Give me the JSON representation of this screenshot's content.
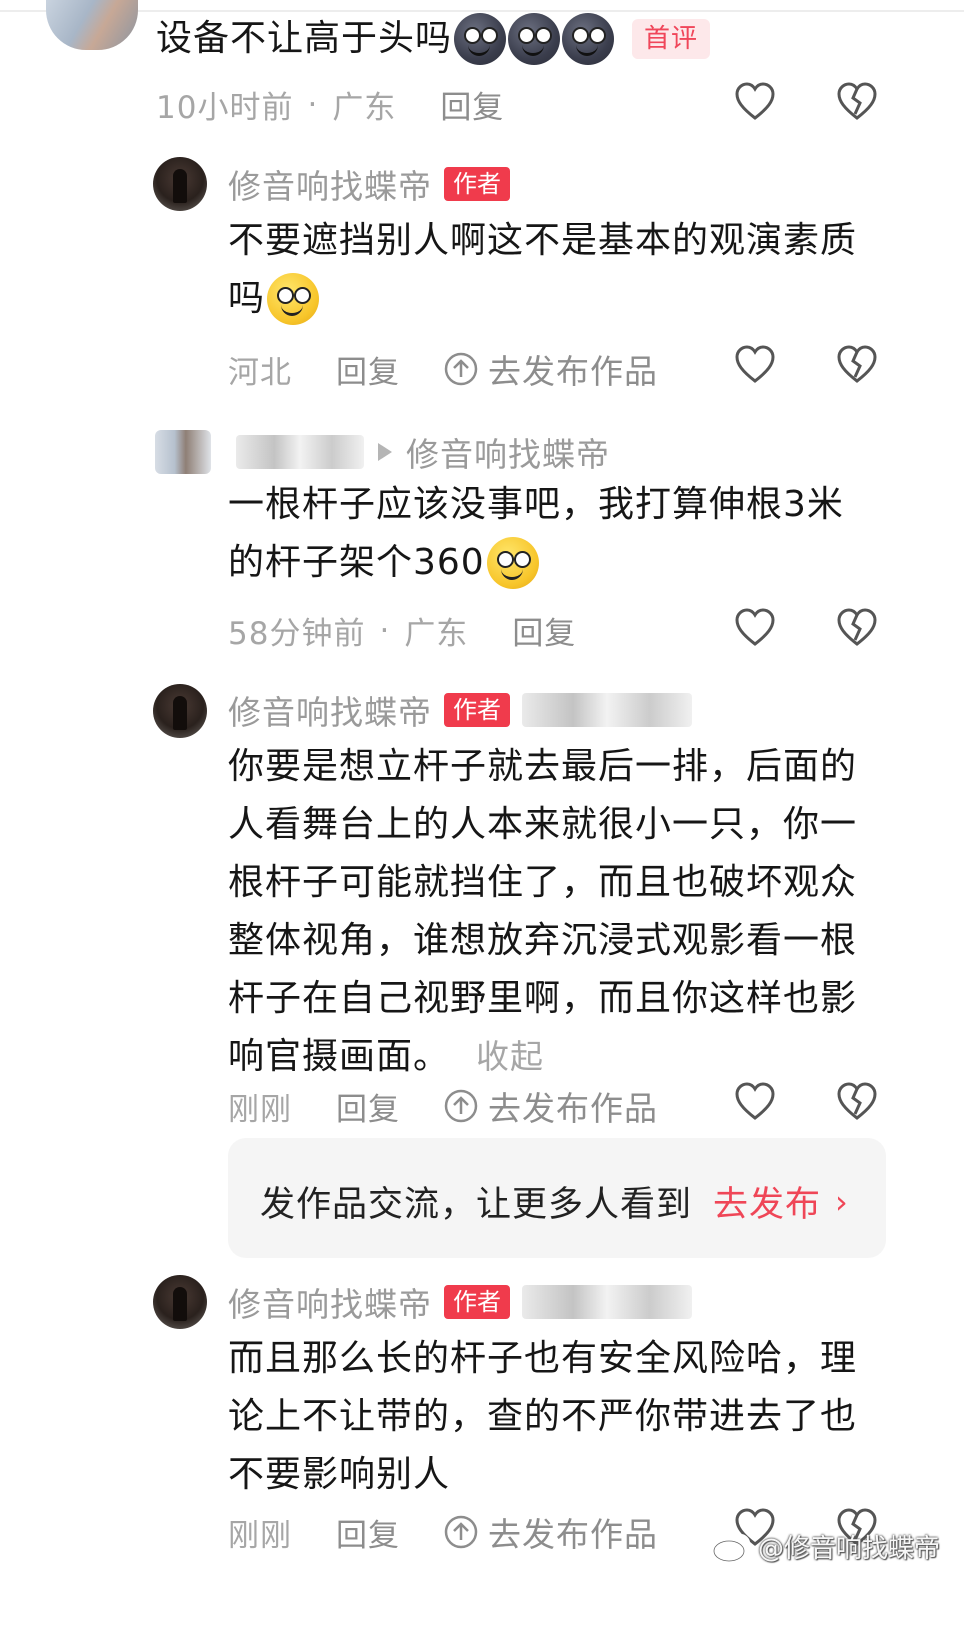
{
  "colors": {
    "accent": "#ef4657",
    "author_badge": "#f03b4c",
    "meta": "#a6a6a6"
  },
  "comments": [
    {
      "text": "设备不让高于头吗",
      "emojis": [
        "dark-moon-face",
        "dark-moon-face",
        "dark-moon-face"
      ],
      "badge": "首评",
      "time": "10小时前",
      "location": "广东",
      "reply_label": "回复"
    },
    {
      "username": "修音响找蝶帝",
      "badge": "作者",
      "text_line1": "不要遮挡别人啊这不是基本的观演素质",
      "text_line2": "吗",
      "emojis": [
        "grin-face"
      ],
      "location": "河北",
      "reply_label": "回复",
      "publish_label": "去发布作品"
    },
    {
      "reply_to": "修音响找蝶帝",
      "text_line1": "一根杆子应该没事吧，我打算伸根3米",
      "text_line2": "的杆子架个360",
      "emojis": [
        "grin-face"
      ],
      "time": "58分钟前",
      "location": "广东",
      "reply_label": "回复"
    },
    {
      "username": "修音响找蝶帝",
      "badge": "作者",
      "text_lines": [
        "你要是想立杆子就去最后一排，后面的",
        "人看舞台上的人本来就很小一只，你一",
        "根杆子可能就挡住了，而且也破坏观众",
        "整体视角，谁想放弃沉浸式观影看一根",
        "杆子在自己视野里啊，而且你这样也影",
        "响官摄画面。"
      ],
      "collapse_label": "收起",
      "time": "刚刚",
      "reply_label": "回复",
      "publish_label": "去发布作品"
    },
    {
      "username": "修音响找蝶帝",
      "badge": "作者",
      "text_lines": [
        "而且那么长的杆子也有安全风险哈，理",
        "论上不让带的，查的不严你带进去了也",
        "不要影响别人"
      ],
      "time": "刚刚",
      "reply_label": "回复",
      "publish_label": "去发布作品"
    }
  ],
  "promo": {
    "text": "发作品交流，让更多人看到",
    "link_label": "去发布",
    "chevron": "›"
  },
  "watermark": {
    "text": "@修音响找蝶帝",
    "icon": "weibo-icon"
  }
}
